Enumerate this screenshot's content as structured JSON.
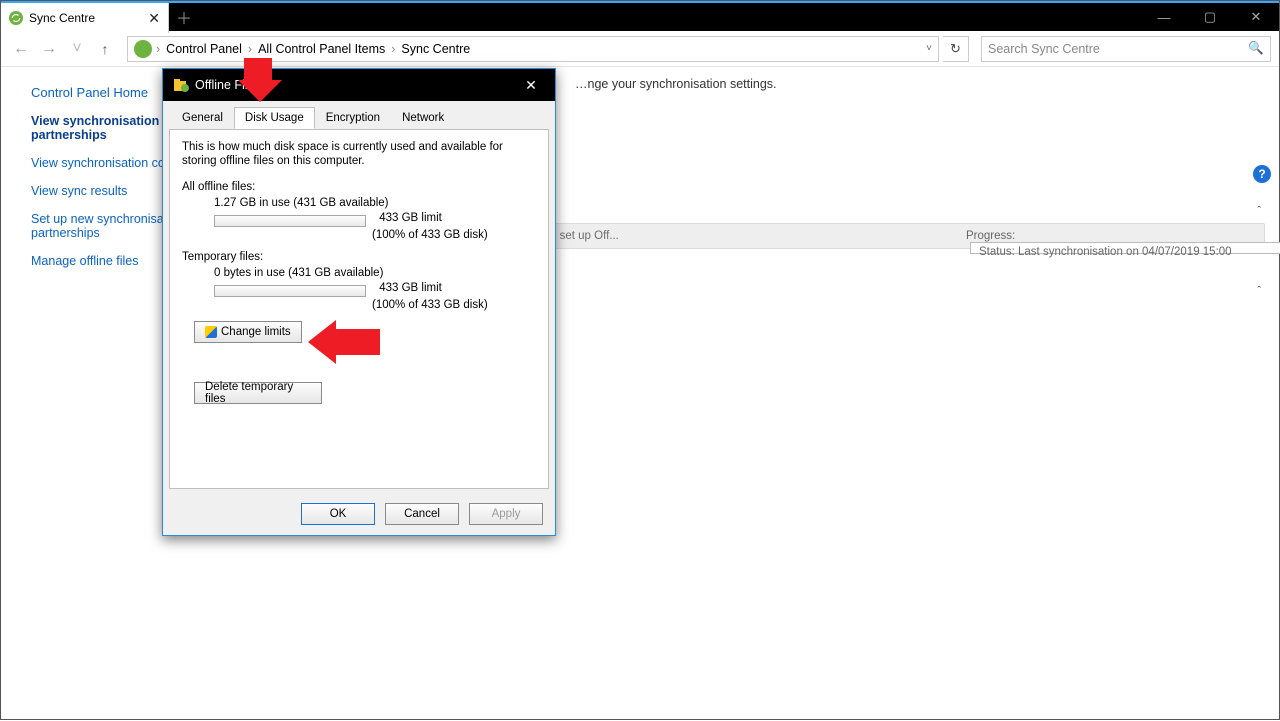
{
  "tab": {
    "title": "Sync Centre"
  },
  "winctl": {
    "min": "—",
    "max": "▢",
    "close": "✕"
  },
  "newtab": "＋",
  "nav": {
    "back": "←",
    "forward": "→",
    "up": "↑"
  },
  "breadcrumb": {
    "a": "Control Panel",
    "b": "All Control Panel Items",
    "c": "Sync Centre",
    "sep": "›"
  },
  "addr": {
    "drop": "˅",
    "refresh": "↻"
  },
  "search": {
    "placeholder": "Search Sync Centre"
  },
  "sidebar": {
    "home": "Control Panel Home",
    "l1": "View synchronisation partnerships",
    "l2": "View synchronisation conflicts",
    "l3": "View sync results",
    "l4": "Set up new synchronisation partnerships",
    "l5": "Manage offline files"
  },
  "content": {
    "intro": "…nge your synchronisation settings.",
    "band_hint": "…rking offline. To set up Off...",
    "progress_label": "Progress:",
    "status_label": "Status:",
    "status_value": "Last synchronisation on 04/07/2019 15:00",
    "helpmark": "?"
  },
  "dialog": {
    "title": "Offline Files",
    "tabs": {
      "general": "General",
      "disk": "Disk Usage",
      "enc": "Encryption",
      "net": "Network"
    },
    "desc": "This is how much disk space is currently used and available for storing offline files on this computer.",
    "all_label": "All offline files:",
    "all_use": "1.27 GB in use (431 GB available)",
    "all_limit": "433 GB limit",
    "all_pct": "(100% of 433 GB disk)",
    "tmp_label": "Temporary files:",
    "tmp_use": "0 bytes in use (431 GB available)",
    "tmp_limit": "433 GB limit",
    "tmp_pct": "(100% of 433 GB disk)",
    "change_btn": "Change limits",
    "delete_btn": "Delete temporary files",
    "ok": "OK",
    "cancel": "Cancel",
    "apply": "Apply",
    "close": "✕"
  }
}
